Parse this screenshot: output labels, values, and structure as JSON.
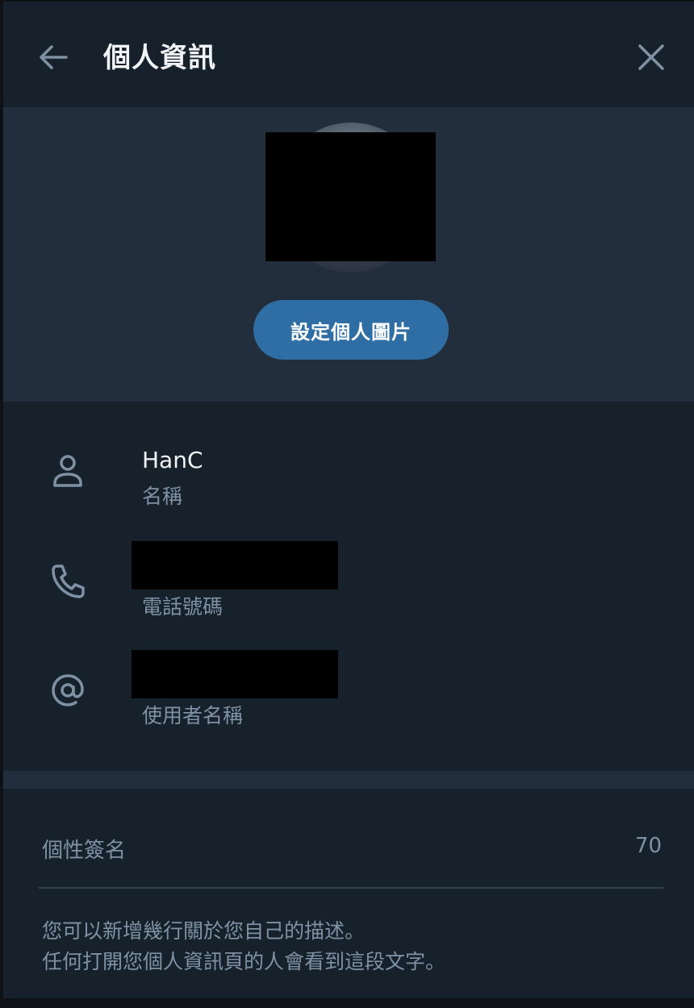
{
  "header": {
    "title": "個人資訊"
  },
  "avatar_section": {
    "set_photo_label": "設定個人圖片"
  },
  "info_rows": [
    {
      "value": "HanC",
      "label": "名稱",
      "icon": "user-icon"
    },
    {
      "value": "",
      "label": "電話號碼",
      "icon": "phone-icon"
    },
    {
      "value": "",
      "label": "使用者名稱",
      "icon": "at-icon"
    }
  ],
  "bio": {
    "placeholder": "個性簽名",
    "counter": "70",
    "help_lines": [
      "您可以新增幾行關於您自己的描述。",
      "任何打開您個人資訊頁的人會看到這段文字。"
    ]
  },
  "colors": {
    "background": "#17212b",
    "section_bg": "#232e3c",
    "accent": "#2f6ea5",
    "secondary_text": "#7f91a4"
  }
}
